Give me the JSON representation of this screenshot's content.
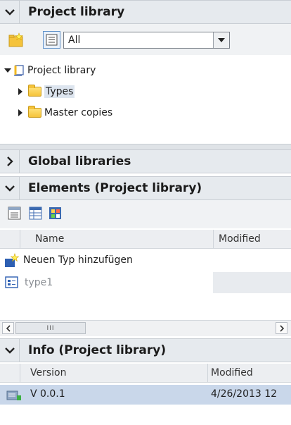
{
  "project_library": {
    "title": "Project library",
    "filter_value": "All",
    "tree": {
      "root_label": "Project library",
      "children": [
        {
          "label": "Types"
        },
        {
          "label": "Master copies"
        }
      ]
    }
  },
  "global_libraries": {
    "title": "Global libraries"
  },
  "elements": {
    "title": "Elements (Project library)",
    "columns": {
      "name": "Name",
      "modified": "Modified"
    },
    "rows": [
      {
        "name": "Neuen Typ hinzufügen",
        "modified": ""
      },
      {
        "name": "type1",
        "modified": ""
      }
    ],
    "scroll_grip": "III"
  },
  "info": {
    "title": "Info (Project library)",
    "columns": {
      "version": "Version",
      "modified": "Modified"
    },
    "rows": [
      {
        "version": "V 0.0.1",
        "modified": "4/26/2013 12"
      }
    ]
  },
  "icons": [
    "chevron-down-icon",
    "chevron-right-icon",
    "new-folder-icon",
    "list-view-icon",
    "library-icon",
    "folder-icon",
    "add-type-icon",
    "type-icon",
    "details-view-icon",
    "tiles-view-icon",
    "version-icon"
  ],
  "colors": {
    "header_bg": "#e6eaee",
    "selected_bg": "#c9d7ea",
    "folder": "#f5c33b"
  }
}
